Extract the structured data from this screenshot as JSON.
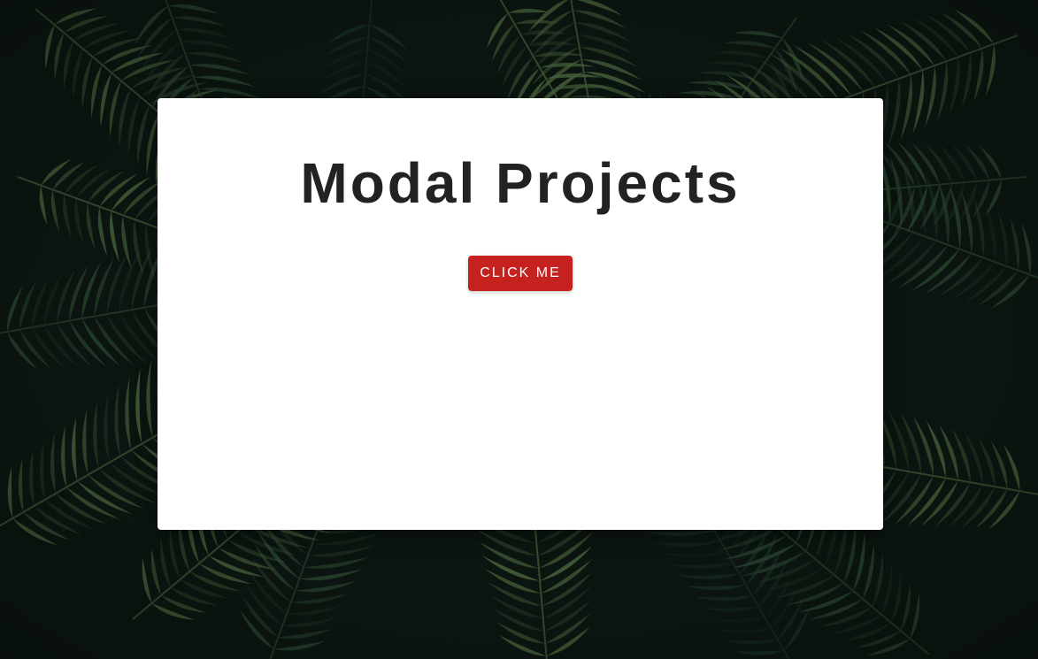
{
  "page": {
    "title": "Modal Projects",
    "button_label": "CLICK ME"
  },
  "background": {
    "description_icon": "palm-leaves-image",
    "base_color": "#0d1712",
    "leaf_light": "#5d7f4c",
    "leaf_mid": "#35573c",
    "leaf_dark": "#1d3a2e"
  },
  "colors": {
    "card": "#ffffff",
    "title": "#222222",
    "button": "#c5211f",
    "button_text": "#ffffff"
  }
}
